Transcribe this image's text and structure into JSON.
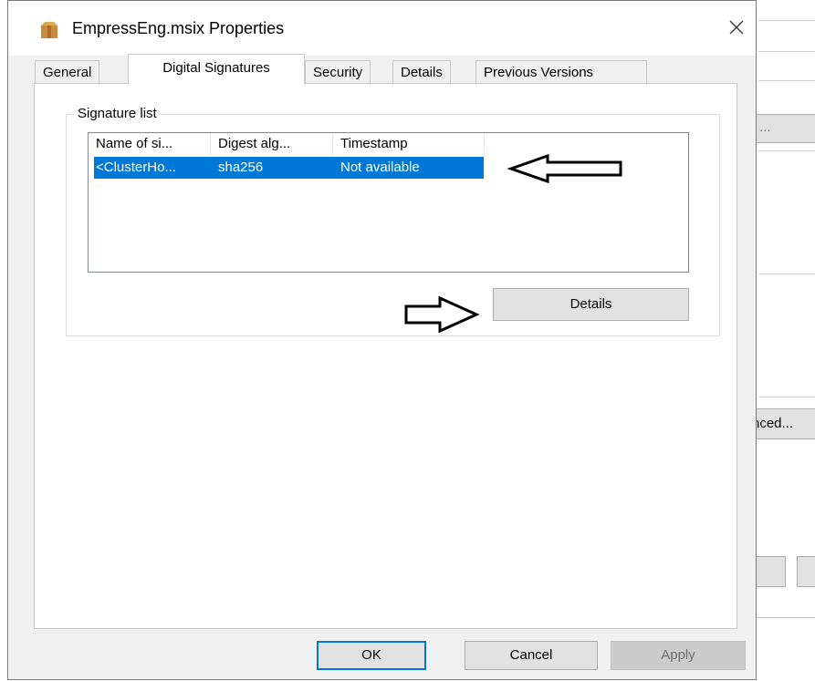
{
  "dialog": {
    "title": "EmpressEng.msix Properties",
    "tabs": [
      {
        "label": "General",
        "active": false
      },
      {
        "label": "Digital Signatures",
        "active": true
      },
      {
        "label": "Security",
        "active": false
      },
      {
        "label": "Details",
        "active": false
      },
      {
        "label": "Previous Versions",
        "active": false
      }
    ],
    "signature_list": {
      "legend": "Signature list",
      "columns": [
        "Name of si...",
        "Digest alg...",
        "Timestamp"
      ],
      "rows": [
        {
          "name": "<ClusterHo...",
          "digest": "sha256",
          "timestamp": "Not available",
          "selected": true
        }
      ]
    },
    "details_button": "Details",
    "footer": {
      "ok": "OK",
      "cancel": "Cancel",
      "apply": "Apply"
    }
  },
  "background_window": {
    "button_ellipsis": "...",
    "advanced_button": "nced..."
  },
  "colors": {
    "selection": "#0078d7",
    "dialog_bg": "#f0f0f0",
    "panel_bg": "#ffffff"
  }
}
